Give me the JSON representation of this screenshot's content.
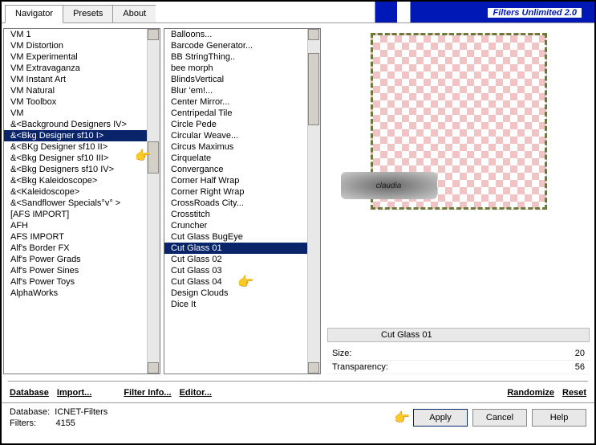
{
  "app_title": "Filters Unlimited 2.0",
  "tabs": {
    "navigator": "Navigator",
    "presets": "Presets",
    "about": "About"
  },
  "categories": {
    "items": [
      "VM 1",
      "VM Distortion",
      "VM Experimental",
      "VM Extravaganza",
      "VM Instant Art",
      "VM Natural",
      "VM Toolbox",
      "VM",
      "&<Background Designers IV>",
      "&<Bkg Designer sf10 I>",
      "&<BKg Designer sf10 II>",
      "&<Bkg Designer sf10 III>",
      "&<Bkg Designers sf10 IV>",
      "&<Bkg Kaleidoscope>",
      "&<Kaleidoscope>",
      "&<Sandflower Specials°v° >",
      "[AFS IMPORT]",
      "AFH",
      "AFS IMPORT",
      "Alf's Border FX",
      "Alf's Power Grads",
      "Alf's Power Sines",
      "Alf's Power Toys",
      "AlphaWorks"
    ],
    "selected_index": 9
  },
  "filters": {
    "items": [
      "Balloons...",
      "Barcode Generator...",
      "BB StringThing..",
      "bee morph",
      "BlindsVertical",
      "Blur 'em!...",
      "Center Mirror...",
      "Centripedal Tile",
      "Circle Pede",
      "Circular Weave...",
      "Circus Maximus",
      "Cirquelate",
      "Convergance",
      "Corner Half Wrap",
      "Corner Right Wrap",
      "CrossRoads City...",
      "Crosstitch",
      "Cruncher",
      "Cut Glass  BugEye",
      "Cut Glass 01",
      "Cut Glass 02",
      "Cut Glass 03",
      "Cut Glass 04",
      "Design Clouds",
      "Dice It"
    ],
    "selected_index": 19
  },
  "preview": {
    "badge": "claudia",
    "title": "Cut Glass 01"
  },
  "params": {
    "rows": [
      {
        "label": "Size:",
        "value": "20"
      },
      {
        "label": "Transparency:",
        "value": "56"
      }
    ]
  },
  "links": {
    "database": "Database",
    "import": "Import...",
    "filterinfo": "Filter Info...",
    "editor": "Editor...",
    "randomize": "Randomize",
    "reset": "Reset"
  },
  "footer": {
    "db_label": "Database:",
    "db_value": "ICNET-Filters",
    "filters_label": "Filters:",
    "filters_value": "4155"
  },
  "buttons": {
    "apply": "Apply",
    "cancel": "Cancel",
    "help": "Help"
  }
}
